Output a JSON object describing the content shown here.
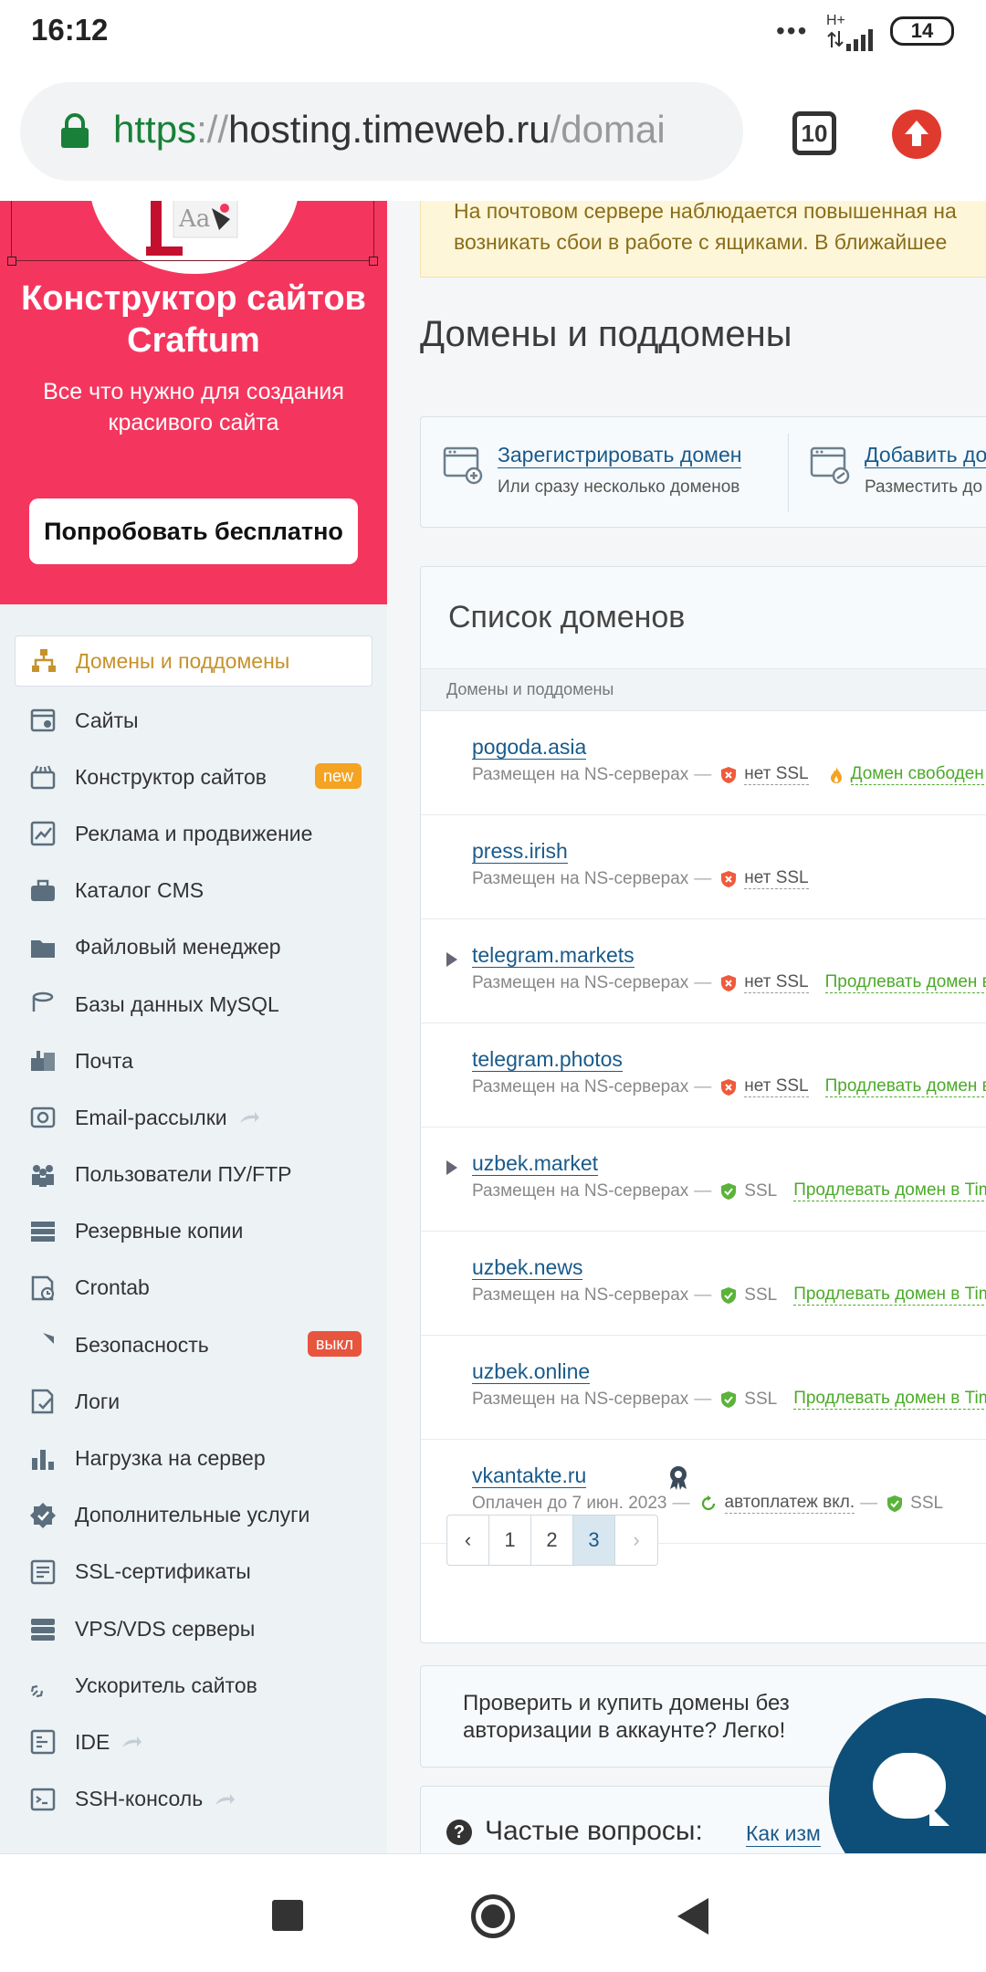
{
  "statusbar": {
    "time": "16:12",
    "dots": "•••",
    "network": "H+",
    "battery": "14"
  },
  "browser": {
    "url_scheme": "https",
    "url_sep": "://",
    "url_host": "hosting.timeweb.ru",
    "url_rest": "/domai",
    "tab_count": "10"
  },
  "promo": {
    "title": "Конструктор сайтов Craftum",
    "subtitle": "Все что нужно для создания красивого сайта",
    "cta": "Попробовать бесплатно"
  },
  "menu": [
    {
      "label": "Домены и поддомены",
      "icon": "sitemap-icon",
      "active": true
    },
    {
      "label": "Сайты",
      "icon": "window-gear-icon"
    },
    {
      "label": "Конструктор сайтов",
      "icon": "builder-icon",
      "badge": "new"
    },
    {
      "label": "Реклама и продвижение",
      "icon": "chart-line-icon"
    },
    {
      "label": "Каталог CMS",
      "icon": "briefcase-icon"
    },
    {
      "label": "Файловый менеджер",
      "icon": "folder-icon"
    },
    {
      "label": "Базы данных MySQL",
      "icon": "database-icon"
    },
    {
      "label": "Почта",
      "icon": "mailbox-icon"
    },
    {
      "label": "Email-рассылки",
      "icon": "email-icon",
      "arrow": true
    },
    {
      "label": "Пользователи ПУ/FTP",
      "icon": "users-icon"
    },
    {
      "label": "Резервные копии",
      "icon": "server-icon"
    },
    {
      "label": "Crontab",
      "icon": "clock-file-icon"
    },
    {
      "label": "Безопасность",
      "icon": "shield-icon",
      "badge": "выкл"
    },
    {
      "label": "Логи",
      "icon": "log-check-icon"
    },
    {
      "label": "Нагрузка на сервер",
      "icon": "bar-chart-icon"
    },
    {
      "label": "Дополнительные услуги",
      "icon": "badge-check-icon"
    },
    {
      "label": "SSL-сертификаты",
      "icon": "certificate-icon"
    },
    {
      "label": "VPS/VDS серверы",
      "icon": "vps-icon"
    },
    {
      "label": "Ускоритель сайтов",
      "icon": "rocket-icon"
    },
    {
      "label": "IDE",
      "icon": "ide-icon",
      "arrow": true
    },
    {
      "label": "SSH-консоль",
      "icon": "terminal-icon",
      "arrow": true
    }
  ],
  "notice": {
    "line1": "На почтовом сервере наблюдается повышенная на",
    "line2": "возникать сбои в работе с ящиками. В ближайшее "
  },
  "page_title": "Домены и поддомены",
  "actions": [
    {
      "title": "Зарегистрировать домен",
      "subtitle": "Или сразу несколько доменов"
    },
    {
      "title": "Добавить до",
      "subtitle": "Разместить до"
    }
  ],
  "list": {
    "title": "Список доменов",
    "column": "Домены и поддомены",
    "placed_text": "Размещен на NS-серверах",
    "dash": "—",
    "no_ssl": "нет SSL",
    "ssl": "SSL",
    "rows": [
      {
        "name": "pogoda.asia",
        "ssl": false,
        "extra_type": "free",
        "extra": "Домен свободен",
        "caret": false
      },
      {
        "name": "press.irish",
        "ssl": false,
        "extra_type": "",
        "extra": "",
        "caret": false
      },
      {
        "name": "telegram.markets",
        "ssl": false,
        "extra_type": "renew",
        "extra": "Продлевать домен в T",
        "caret": true
      },
      {
        "name": "telegram.photos",
        "ssl": false,
        "extra_type": "renew",
        "extra": "Продлевать домен в T",
        "caret": false
      },
      {
        "name": "uzbek.market",
        "ssl": true,
        "extra_type": "renew",
        "extra": "Продлевать домен в Time",
        "caret": true
      },
      {
        "name": "uzbek.news",
        "ssl": true,
        "extra_type": "renew",
        "extra": "Продлевать домен в Time",
        "caret": false
      },
      {
        "name": "uzbek.online",
        "ssl": true,
        "extra_type": "renew",
        "extra": "Продлевать домен в Time",
        "caret": false
      }
    ],
    "paid_row": {
      "name": "vkantakte.ru",
      "paid_until": "Оплачен до 7 июн. 2023",
      "autopay": "автоплатеж вкл.",
      "ssl": "SSL"
    },
    "pager": {
      "prev": "‹",
      "pages": [
        "1",
        "2",
        "3"
      ],
      "current": "3",
      "next": "›"
    }
  },
  "check_text": "Проверить и купить домены без авторизации в аккаунте? Легко!",
  "faq": {
    "icon": "?",
    "title": "Частые вопросы:",
    "link": "Как изм"
  },
  "colors": {
    "promo_bg": "#f4365e",
    "accent_active": "#c6922b",
    "link": "#1a5a8a",
    "ok_green": "#4caa2a",
    "chat_bg": "#0d4f78"
  }
}
